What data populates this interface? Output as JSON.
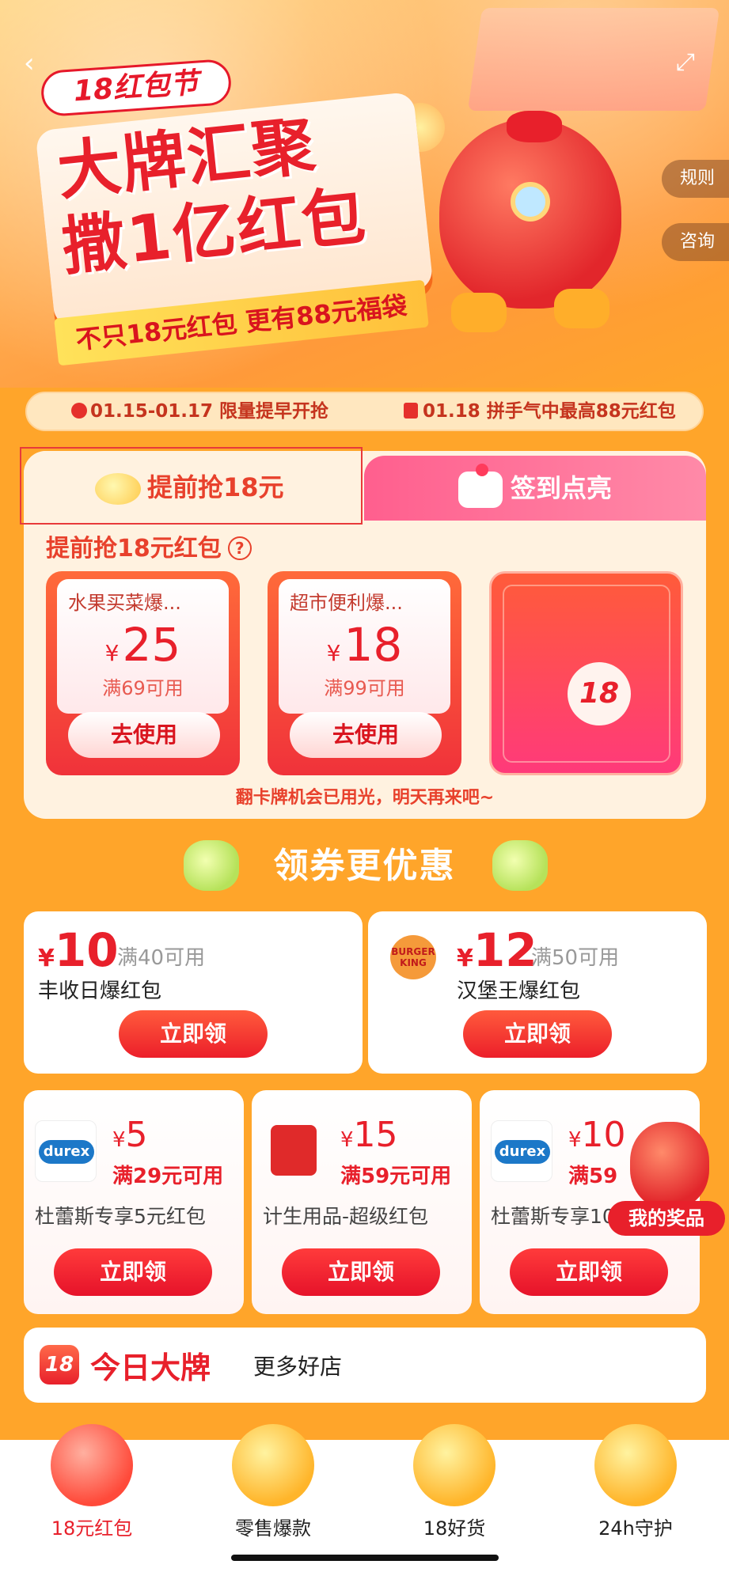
{
  "hero": {
    "festival_logo": "18红包节",
    "headline_line1": "大牌汇聚",
    "headline_line2": "撒1亿红包",
    "subline": "不只18元红包 更有88元福袋",
    "side_rules": "规则",
    "side_consult": "咨询"
  },
  "time_strip": {
    "left": "01.15-01.17 限量提早开抢",
    "right": "01.18 拼手气中最高88元红包"
  },
  "tabs": {
    "active_label": "提前抢18元",
    "inactive_label": "签到点亮"
  },
  "early_section": {
    "title": "提前抢18元红包",
    "coupons": [
      {
        "name": "水果买菜爆...",
        "currency": "¥",
        "amount": "25",
        "condition": "满69可用",
        "button": "去使用"
      },
      {
        "name": "超市便利爆...",
        "currency": "¥",
        "amount": "18",
        "condition": "满99可用",
        "button": "去使用"
      }
    ],
    "flip_card_value": "18",
    "note": "翻卡牌机会已用光，明天再来吧~"
  },
  "coupon_section": {
    "title": "领券更优惠",
    "big": [
      {
        "currency": "¥",
        "amount": "10",
        "condition": "满40可用",
        "name": "丰收日爆红包",
        "button": "立即领"
      },
      {
        "logo": "BURGER KING",
        "currency": "¥",
        "amount": "12",
        "condition": "满50可用",
        "name": "汉堡王爆红包",
        "button": "立即领"
      }
    ],
    "small": [
      {
        "brand": "durex",
        "currency": "¥",
        "amount": "5",
        "condition": "满29元可用",
        "name": "杜蕾斯专享5元红包",
        "button": "立即领"
      },
      {
        "brand": "envelope",
        "currency": "¥",
        "amount": "15",
        "condition": "满59元可用",
        "name": "计生用品-超级红包",
        "button": "立即领"
      },
      {
        "brand": "durex",
        "currency": "¥",
        "amount": "10",
        "condition": "满59",
        "name": "杜蕾斯专享10",
        "button": "立即领"
      }
    ],
    "prize_label": "我的奖品"
  },
  "brand_bar": {
    "badge": "18",
    "title": "今日大牌",
    "more": "更多好店"
  },
  "bottom_nav": [
    {
      "label": "18元红包",
      "active": true
    },
    {
      "label": "零售爆款",
      "active": false
    },
    {
      "label": "18好货",
      "active": false
    },
    {
      "label": "24h守护",
      "active": false
    }
  ],
  "colors": {
    "accent": "#e8202b",
    "background": "#ffa52a",
    "pink_tab": "#ff5f8e"
  }
}
